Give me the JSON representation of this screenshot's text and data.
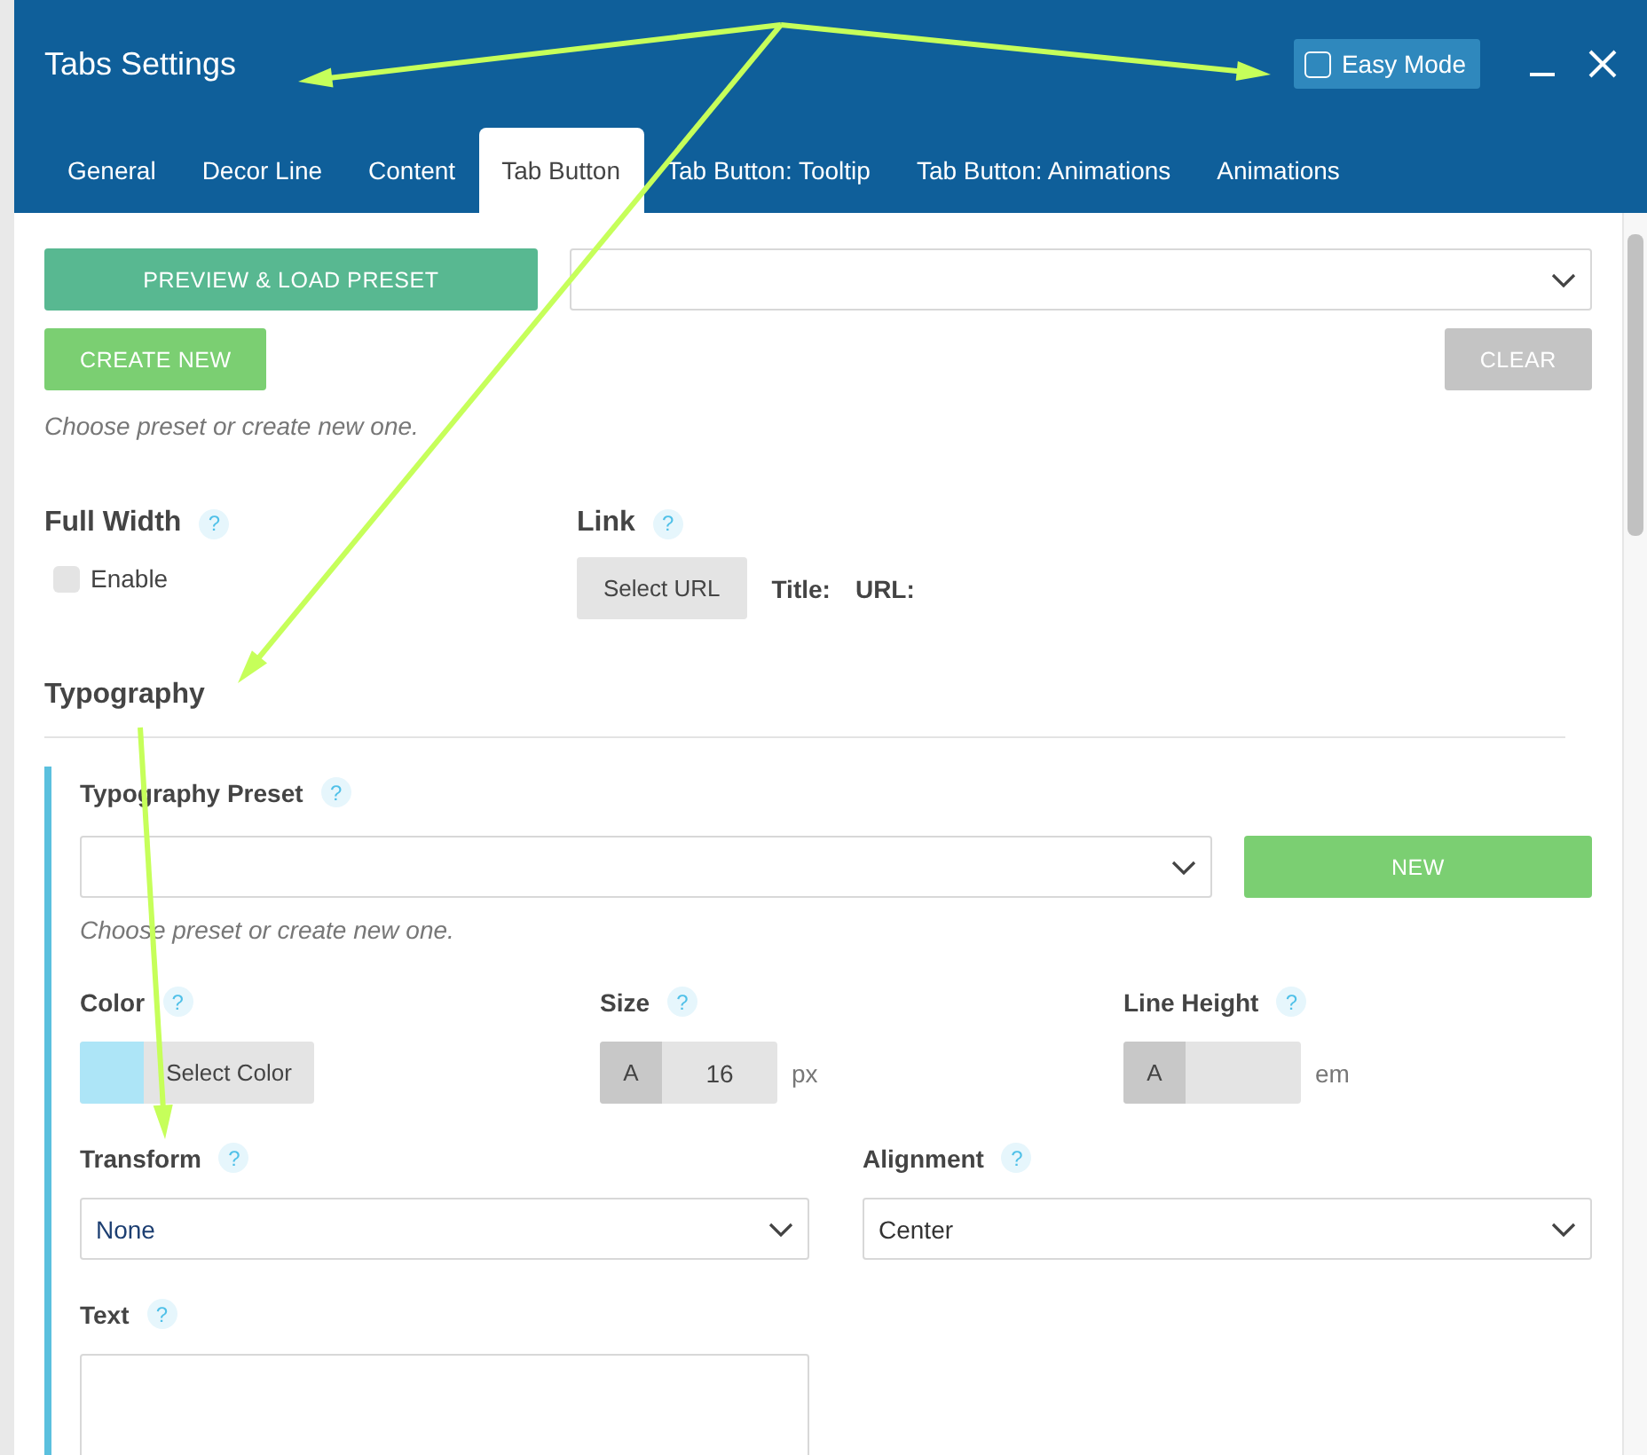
{
  "window": {
    "title": "Tabs Settings"
  },
  "easy_mode": {
    "label": "Easy Mode",
    "checked": false
  },
  "tabs": [
    {
      "label": "General",
      "selected": false
    },
    {
      "label": "Decor Line",
      "selected": false
    },
    {
      "label": "Content",
      "selected": false
    },
    {
      "label": "Tab Button",
      "selected": true
    },
    {
      "label": "Tab Button: Tooltip",
      "selected": false
    },
    {
      "label": "Tab Button: Animations",
      "selected": false
    },
    {
      "label": "Animations",
      "selected": false
    }
  ],
  "main_preset": {
    "load_button": "PREVIEW & LOAD PRESET",
    "create_button": "CREATE NEW",
    "clear_button": "CLEAR",
    "hint": "Choose preset or create new one."
  },
  "full_width": {
    "label": "Full Width",
    "help": "?",
    "checkbox": {
      "label": "Enable",
      "checked": false
    }
  },
  "link": {
    "label": "Link",
    "help": "?",
    "button": "Select URL",
    "title_label": "Title:",
    "url_label": "URL:"
  },
  "typography": {
    "heading": "Typography",
    "preset": {
      "label": "Typography Preset",
      "help": "?",
      "new_button": "NEW",
      "hint": "Choose preset or create new one."
    },
    "color": {
      "label": "Color",
      "help": "?",
      "button": "Select Color"
    },
    "size": {
      "label": "Size",
      "help": "?",
      "prefix": "A",
      "value": "16",
      "unit": "px"
    },
    "line_height": {
      "label": "Line Height",
      "help": "?",
      "prefix": "A",
      "unit": "em"
    },
    "transform": {
      "label": "Transform",
      "help": "?",
      "value": "None"
    },
    "alignment": {
      "label": "Alignment",
      "help": "?",
      "value": "Center"
    },
    "text": {
      "label": "Text",
      "help": "?"
    }
  }
}
